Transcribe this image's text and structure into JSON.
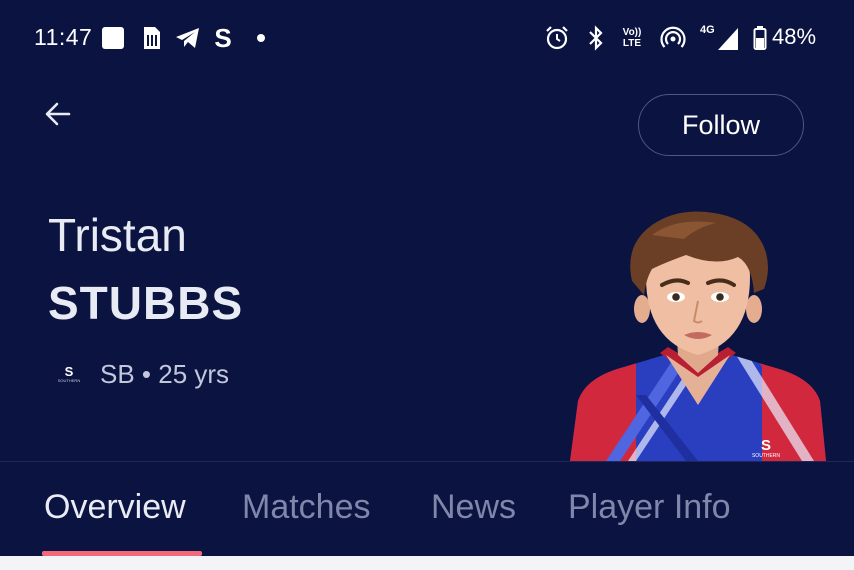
{
  "status_bar": {
    "time": "11:47",
    "battery": "48%",
    "network": "4G",
    "volte": [
      "Vo))",
      "LTE"
    ],
    "app_letter": "S",
    "icons": [
      "notification-square-icon",
      "sim-card-icon",
      "telegram-icon",
      "s-app-icon",
      "dot-icon",
      "alarm-icon",
      "bluetooth-icon",
      "volte-icon",
      "hotspot-icon",
      "signal-icon",
      "battery-icon"
    ]
  },
  "header": {
    "back_icon": "arrow-left-icon",
    "follow_label": "Follow"
  },
  "player": {
    "first_name": "Tristan",
    "last_name": "STUBBS",
    "team_meta": "SB • 25 yrs",
    "team_logo_letter": "S",
    "team_logo_sub": "SOUTHERN",
    "jersey_letter": "S",
    "jersey_sub": "SOUTHERN"
  },
  "tabs": [
    {
      "label": "Overview",
      "active": true
    },
    {
      "label": "Matches",
      "active": false
    },
    {
      "label": "News",
      "active": false
    },
    {
      "label": "Player Info",
      "active": false
    }
  ],
  "colors": {
    "background": "#0b1340",
    "accent": "#f06a7c",
    "inactive_tab": "#7f87ab"
  }
}
